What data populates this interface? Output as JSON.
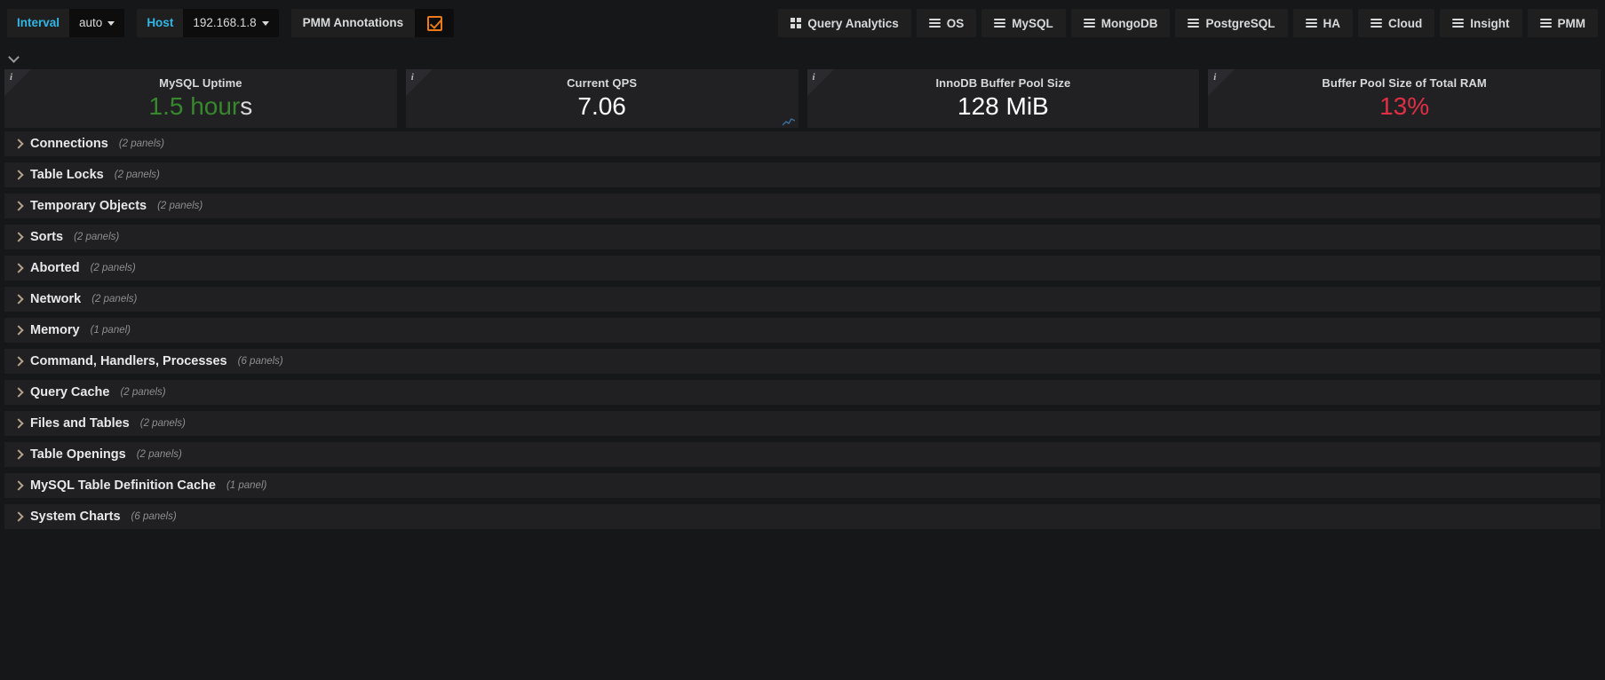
{
  "toolbar": {
    "variables": [
      {
        "label": "Interval",
        "value": "auto",
        "name": "interval"
      },
      {
        "label": "Host",
        "value": "192.168.1.8",
        "name": "host"
      }
    ],
    "annotations": {
      "label": "PMM Annotations",
      "checked": true,
      "checkbox_color": "#eb7b18",
      "icon": "checkbox-checked-icon"
    },
    "nav_links": [
      {
        "label": "Query Analytics",
        "icon": "grid-icon"
      },
      {
        "label": "OS",
        "icon": "menu-icon"
      },
      {
        "label": "MySQL",
        "icon": "menu-icon"
      },
      {
        "label": "MongoDB",
        "icon": "menu-icon"
      },
      {
        "label": "PostgreSQL",
        "icon": "menu-icon"
      },
      {
        "label": "HA",
        "icon": "menu-icon"
      },
      {
        "label": "Cloud",
        "icon": "menu-icon"
      },
      {
        "label": "Insight",
        "icon": "menu-icon"
      },
      {
        "label": "PMM",
        "icon": "menu-icon"
      }
    ],
    "collapse_icon": "chevron-down-icon"
  },
  "stat_panels": [
    {
      "title": "MySQL Uptime",
      "value_main": "1.5 hour",
      "value_suffix": "s",
      "color": "#37872d",
      "suffix_color": "#d8d9da",
      "info_icon": "info-icon"
    },
    {
      "title": "Current QPS",
      "value_main": "7.06",
      "value_suffix": "",
      "color": "#ffffff",
      "suffix_color": "#ffffff",
      "info_icon": "info-icon"
    },
    {
      "title": "InnoDB Buffer Pool Size",
      "value_main": "128 MiB",
      "value_suffix": "",
      "color": "#ffffff",
      "suffix_color": "#ffffff",
      "info_icon": "info-icon"
    },
    {
      "title": "Buffer Pool Size of Total RAM",
      "value_main": "13%",
      "value_suffix": "",
      "color": "#e02f44",
      "suffix_color": "#e02f44",
      "info_icon": "info-icon"
    }
  ],
  "rows": [
    {
      "title": "Connections",
      "count": "(2 panels)"
    },
    {
      "title": "Table Locks",
      "count": "(2 panels)"
    },
    {
      "title": "Temporary Objects",
      "count": "(2 panels)"
    },
    {
      "title": "Sorts",
      "count": "(2 panels)"
    },
    {
      "title": "Aborted",
      "count": "(2 panels)"
    },
    {
      "title": "Network",
      "count": "(2 panels)"
    },
    {
      "title": "Memory",
      "count": "(1 panel)"
    },
    {
      "title": "Command, Handlers, Processes",
      "count": "(6 panels)"
    },
    {
      "title": "Query Cache",
      "count": "(2 panels)"
    },
    {
      "title": "Files and Tables",
      "count": "(2 panels)"
    },
    {
      "title": "Table Openings",
      "count": "(2 panels)"
    },
    {
      "title": "MySQL Table Definition Cache",
      "count": "(1 panel)"
    },
    {
      "title": "System Charts",
      "count": "(6 panels)"
    }
  ]
}
